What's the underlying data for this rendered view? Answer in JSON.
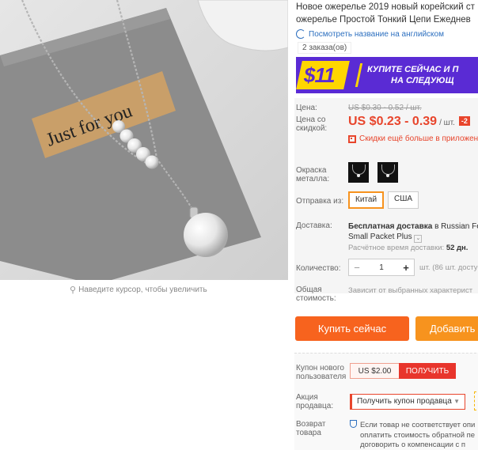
{
  "image": {
    "alt_caption": "Just for you",
    "zoom_hint": "Наведите курсор, чтобы увеличить"
  },
  "product": {
    "title_line1": "Новое ожерелье 2019 новый корейский ст",
    "title_line2": "ожерелье Простой Тонкий Цепи Ежеднев",
    "translate_link": "Посмотреть название на английском",
    "orders": "2 заказа(ов)"
  },
  "promo": {
    "price": "$11",
    "line1": "КУПИТЕ СЕЙЧАС И П",
    "line2": "НА СЛЕДУЮЩ"
  },
  "price": {
    "label": "Цена:",
    "old": "US $0.30 - 0.52 / шт.",
    "discount_label": "Цена со скидкой:",
    "new": "US $0.23 - 0.39",
    "unit": "/ шт.",
    "badge": "-2",
    "app_note": "Скидки ещё больше в приложен"
  },
  "options": {
    "metal_label": "Окраска металла:",
    "ship_from_label": "Отправка из:",
    "ship_from": [
      "Китай",
      "США"
    ],
    "selected_ship_from": "Китай"
  },
  "delivery": {
    "label": "Доставка:",
    "free_prefix": "Бесплатная доставка",
    "method_mid": "в Russian Fe",
    "method_line2": "Small Packet Plus",
    "time_label": "Расчётное время доставки:",
    "time_value": "52 дн."
  },
  "quantity": {
    "label": "Количество:",
    "value": "1",
    "minus": "−",
    "plus": "+",
    "available": "шт. (86 шт. досту"
  },
  "total": {
    "label": "Общая стоимость:",
    "note": "Зависит от выбранных характерист"
  },
  "actions": {
    "buy": "Купить сейчас",
    "cart": "Добавить"
  },
  "coupons": {
    "new_user_label": "Купон нового пользователя",
    "new_user_value": "US $2.00",
    "get": "ПОЛУЧИТЬ",
    "seller_label": "Акция продавца:",
    "seller_coupon": "Получить купон продавца",
    "return_label": "Возврат товара",
    "return_line1": "Если товар не соответствует опи",
    "return_line2": "оплатить стоимость обратной пе",
    "return_line3": "договорить о компенсации с п"
  },
  "colors": {
    "accent": "#e8452c",
    "buy_button": "#f7631e",
    "cart_button": "#f7931e",
    "promo_bg": "#5a2bd4",
    "promo_price": "#ffd600"
  }
}
